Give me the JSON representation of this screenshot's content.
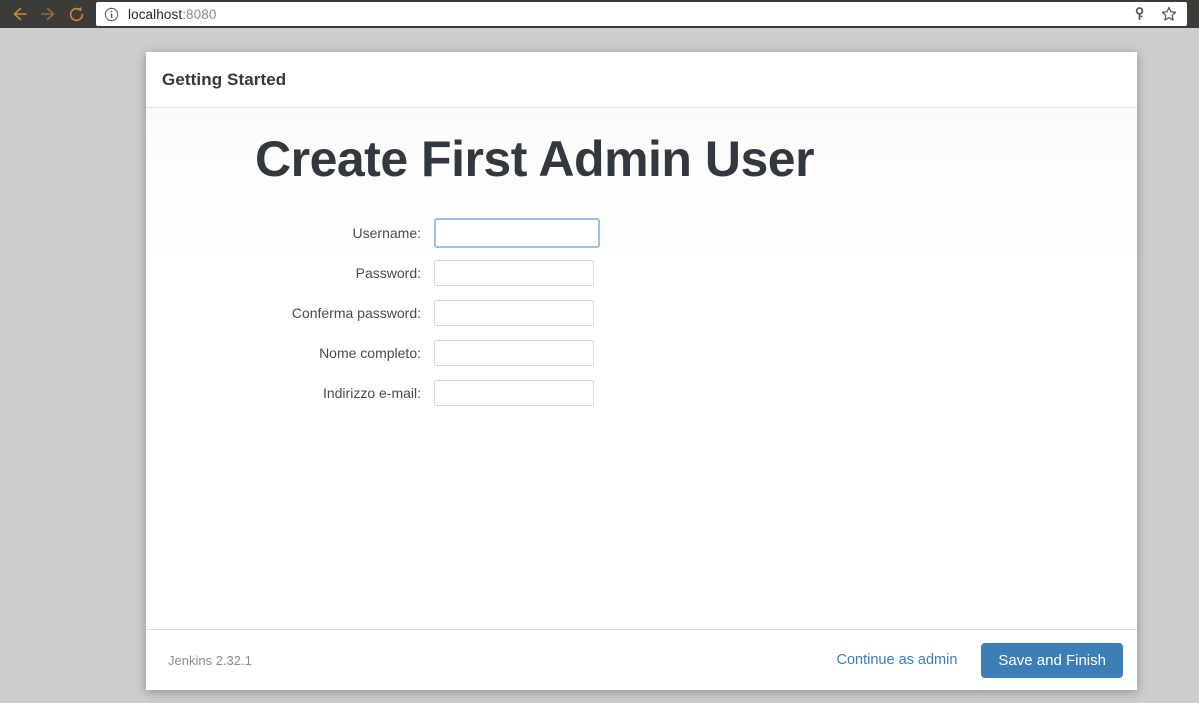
{
  "browser": {
    "nav": {
      "back_label": "Back",
      "back_icon": "arrow-left-icon",
      "forward_label": "Forward",
      "forward_icon": "arrow-right-icon",
      "reload_label": "Reload",
      "reload_icon": "reload-icon"
    },
    "urlbar": {
      "security_icon": "info-circle-icon",
      "host": "localhost",
      "port": ":8080",
      "full_url": "localhost:8080",
      "key_icon": "key-icon",
      "bookmark_icon": "star-icon"
    },
    "colors": {
      "chrome_background": "#3c3b37",
      "nav_icon": "#d1843c",
      "nav_icon_disabled": "#8a6a45",
      "page_background": "#cdcdcd"
    }
  },
  "card": {
    "header": {
      "title": "Getting Started"
    },
    "body": {
      "title": "Create First Admin User",
      "form": {
        "fields": [
          {
            "label": "Username:",
            "value": "",
            "placeholder": "",
            "type": "text",
            "name": "username",
            "focused": true
          },
          {
            "label": "Password:",
            "value": "",
            "placeholder": "",
            "type": "password",
            "name": "password",
            "focused": false
          },
          {
            "label": "Conferma password:",
            "value": "",
            "placeholder": "",
            "type": "password",
            "name": "confirm-password",
            "focused": false
          },
          {
            "label": "Nome completo:",
            "value": "",
            "placeholder": "",
            "type": "text",
            "name": "fullname",
            "focused": false
          },
          {
            "label": "Indirizzo e-mail:",
            "value": "",
            "placeholder": "",
            "type": "text",
            "name": "email",
            "focused": false
          }
        ]
      }
    },
    "footer": {
      "version": "Jenkins 2.32.1",
      "continue_link": "Continue as admin",
      "save_button": "Save and Finish",
      "accent_color": "#3b7fb6",
      "link_color": "#3a7fb5"
    }
  }
}
